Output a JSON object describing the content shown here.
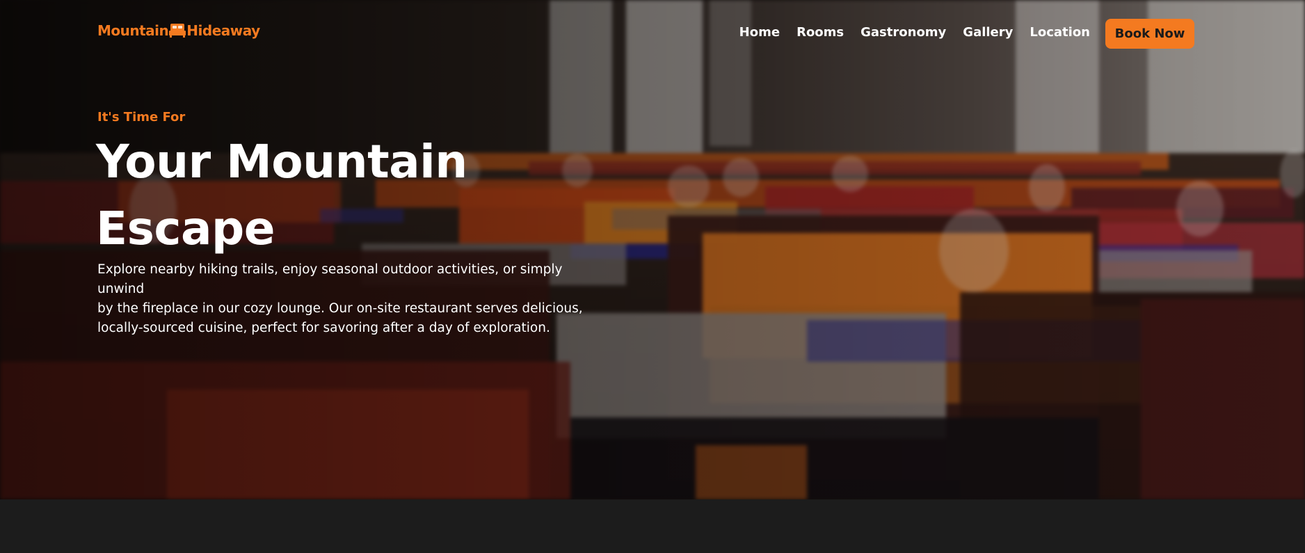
{
  "brand": {
    "name_part1": "Mountain",
    "name_part2": "Hideaway",
    "icon": "bed-icon",
    "accent_color": "#f47a20"
  },
  "nav": {
    "items": [
      {
        "label": "Home"
      },
      {
        "label": "Rooms"
      },
      {
        "label": "Gastronomy"
      },
      {
        "label": "Gallery"
      },
      {
        "label": "Location"
      }
    ],
    "cta_label": "Book Now"
  },
  "hero": {
    "kicker": "It's Time For",
    "headline_line1": "Your Mountain",
    "headline_line2": "Escape",
    "description_line1": "Explore nearby hiking trails, enjoy seasonal outdoor activities, or simply unwind",
    "description_line2": "by the fireplace in our cozy lounge. Our on-site restaurant serves delicious,",
    "description_line3": "locally-sourced cuisine, perfect for savoring after a day of exploration."
  }
}
